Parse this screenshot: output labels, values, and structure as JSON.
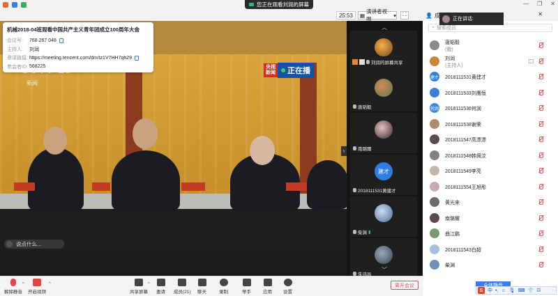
{
  "window": {
    "sharing_banner": "您正在观看刘润的屏幕",
    "timer": "25:53",
    "view_button": "演讲者视图",
    "members_tab": "成员(21)"
  },
  "colors": {
    "accent": "#3b7cf0",
    "danger": "#e04848",
    "live_green": "#1ec06b"
  },
  "meeting_info": {
    "title": "机械2018-04班观看中国共产主义青年团成立100周年大会",
    "rows": [
      {
        "label": "会议号:",
        "value": "768 267 048"
      },
      {
        "label": "主持人:",
        "value": "刘润"
      },
      {
        "label": "邀请链接:",
        "value": "https://meeting.tencent.com/dm/tz1V7HH7qh29"
      },
      {
        "label": "参会者ID:",
        "value": "568225"
      }
    ]
  },
  "video": {
    "channel_logo": "CCTV 13",
    "channel_sub": "新闻",
    "live_tag_a": "央视",
    "live_tag_b": "新闻",
    "live_tag_c": "正在播",
    "chat_hint": "说点什么..."
  },
  "thumbnails": {
    "share_label": "刘润的屏幕共享",
    "tiles": [
      {
        "name": "刘润的屏幕共享"
      },
      {
        "name": "唐韬毅"
      },
      {
        "name": "南璐爾"
      },
      {
        "name": "2018111531黄建才",
        "badge": "建才"
      },
      {
        "name": "柴渊"
      },
      {
        "name": "朱鸿昌"
      }
    ]
  },
  "speaking": {
    "label": "正在讲话:"
  },
  "members": {
    "search_placeholder": "搜索成员",
    "list": [
      {
        "name": "唐韬毅",
        "role": "(我)",
        "color": "#8a8a8a"
      },
      {
        "name": "刘润",
        "role": "(主持人)",
        "color": "#c9853a"
      },
      {
        "name": "2018111531黄建才",
        "avatar_text": "建才",
        "color": "#2f7de1"
      },
      {
        "name": "2018111533刘鹰恒",
        "color": "#3a80d8"
      },
      {
        "name": "2018111536何润",
        "avatar_text": "何润",
        "color": "#3b87e8"
      },
      {
        "name": "2018111538谢荣",
        "color": "#b08c6a"
      },
      {
        "name": "2018111547高漂漂",
        "color": "#5b4c4c"
      },
      {
        "name": "2018111548韩佩汶",
        "color": "#8a7f7a"
      },
      {
        "name": "2018111549李亮",
        "color": "#c7b6a8"
      },
      {
        "name": "2018111554王旭彤",
        "color": "#caa"
      },
      {
        "name": "黄光来",
        "color": "#6b6b6b"
      },
      {
        "name": "南璐爾",
        "color": "#5e4a4a"
      },
      {
        "name": "曲江鹏",
        "color": "#7a9a6a"
      },
      {
        "name": "2018111543白超",
        "color": "#a9c0d9"
      },
      {
        "name": "柴渊",
        "color": "#6f8fb5"
      }
    ]
  },
  "toolbar": {
    "mute": "解除静音",
    "video": "开启视频",
    "share": "共享屏幕",
    "invite": "邀请",
    "members": "成员(21)",
    "chat": "聊天",
    "record": "录制",
    "raise": "举手",
    "apps": "应用",
    "settings": "设置",
    "leave": "离开会议",
    "mute_all": "全体静音"
  },
  "ime": {
    "logo": "S",
    "mode": "中"
  }
}
